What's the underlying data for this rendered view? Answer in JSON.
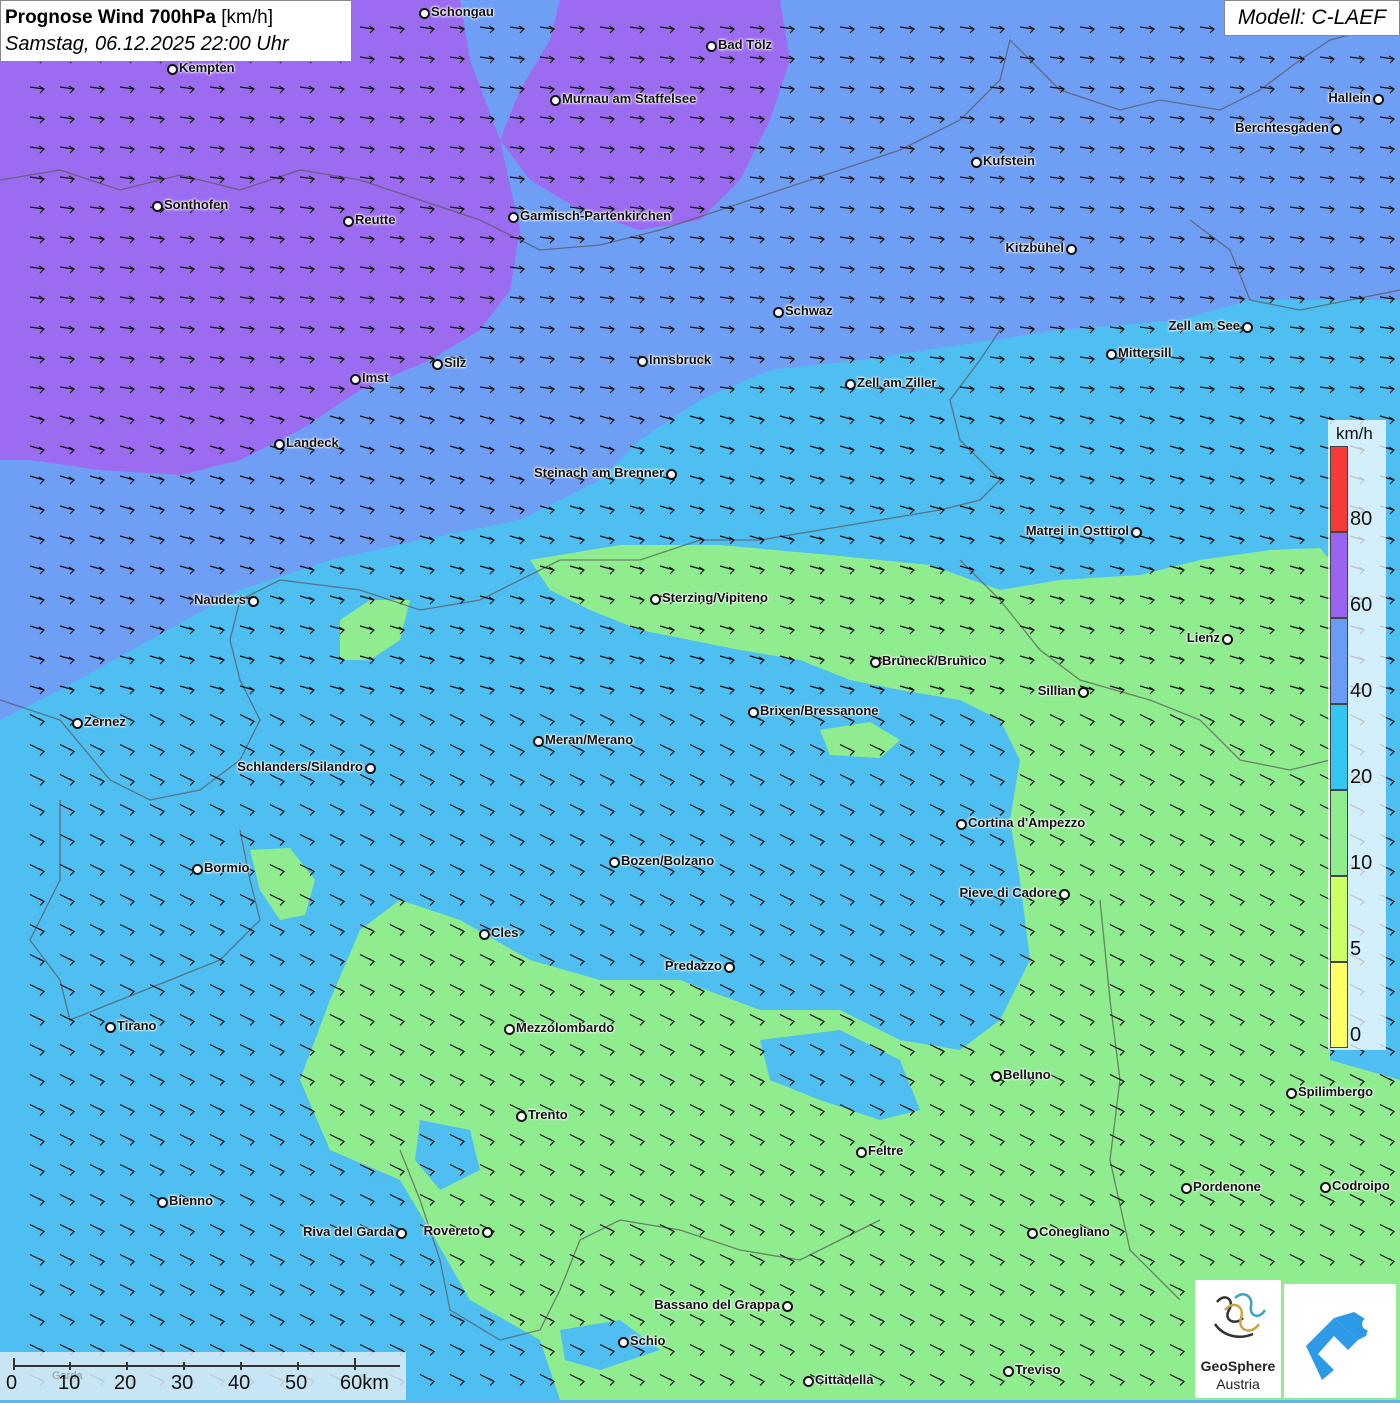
{
  "title": {
    "main": "Prognose Wind 700hPa",
    "unit": "[km/h]",
    "datetime": "Samstag, 06.12.2025 22:00 Uhr"
  },
  "model": "Modell: C-LAEF",
  "legend": {
    "unit": "km/h",
    "bins": [
      {
        "from": 0,
        "to": 5,
        "color": "#ffff66"
      },
      {
        "from": 5,
        "to": 10,
        "color": "#ccff66"
      },
      {
        "from": 10,
        "to": 20,
        "color": "#8fec8f"
      },
      {
        "from": 20,
        "to": 40,
        "color": "#33c6f0"
      },
      {
        "from": 40,
        "to": 60,
        "color": "#6a9cf6"
      },
      {
        "from": 60,
        "to": 80,
        "color": "#9a64f0"
      },
      {
        "from": 80,
        "to": 100,
        "color": "#f53a3a"
      }
    ],
    "ticks": [
      "80",
      "60",
      "40",
      "20",
      "10",
      "5",
      "0"
    ]
  },
  "scale_bar": {
    "labels": [
      "0",
      "10",
      "20",
      "30",
      "40",
      "50",
      "60km"
    ],
    "place_label": "Garda"
  },
  "logos": {
    "geosphere_line1": "GeoSphere",
    "geosphere_line2": "Austria"
  },
  "wind_arrows_direction": "west-northwest",
  "cities": [
    {
      "name": "Schongau"
    },
    {
      "name": "Bad Tölz"
    },
    {
      "name": "Kempten"
    },
    {
      "name": "Murnau am Staffelsee"
    },
    {
      "name": "Hallein"
    },
    {
      "name": "Berchtesgaden"
    },
    {
      "name": "Kufstein"
    },
    {
      "name": "Sonthofen"
    },
    {
      "name": "Reutte"
    },
    {
      "name": "Garmisch-Partenkirchen"
    },
    {
      "name": "Kitzbühel"
    },
    {
      "name": "Schwaz"
    },
    {
      "name": "Zell am See"
    },
    {
      "name": "Mittersill"
    },
    {
      "name": "Innsbruck"
    },
    {
      "name": "Silz"
    },
    {
      "name": "Imst"
    },
    {
      "name": "Zell am Ziller"
    },
    {
      "name": "Landeck"
    },
    {
      "name": "Steinach am Brenner"
    },
    {
      "name": "Matrei in Osttirol"
    },
    {
      "name": "Nauders"
    },
    {
      "name": "Sterzing/Vipiteno"
    },
    {
      "name": "Lienz"
    },
    {
      "name": "Bruneck/Brunico"
    },
    {
      "name": "Sillian"
    },
    {
      "name": "Zernez"
    },
    {
      "name": "Brixen/Bressanone"
    },
    {
      "name": "Meran/Merano"
    },
    {
      "name": "Schlanders/Silandro"
    },
    {
      "name": "Cortina d'Ampezzo"
    },
    {
      "name": "Bormio"
    },
    {
      "name": "Bozen/Bolzano"
    },
    {
      "name": "Pieve di Cadore"
    },
    {
      "name": "Cles"
    },
    {
      "name": "Predazzo"
    },
    {
      "name": "Tirano"
    },
    {
      "name": "Mezzolombardo"
    },
    {
      "name": "Belluno"
    },
    {
      "name": "Spilimbergo"
    },
    {
      "name": "Trento"
    },
    {
      "name": "Feltre"
    },
    {
      "name": "Pordenone"
    },
    {
      "name": "Codroipo"
    },
    {
      "name": "Bienno"
    },
    {
      "name": "Riva del Garda"
    },
    {
      "name": "Rovereto"
    },
    {
      "name": "Conegliano"
    },
    {
      "name": "Bassano del Grappa"
    },
    {
      "name": "Schio"
    },
    {
      "name": "Treviso"
    },
    {
      "name": "Cittadella"
    }
  ]
}
